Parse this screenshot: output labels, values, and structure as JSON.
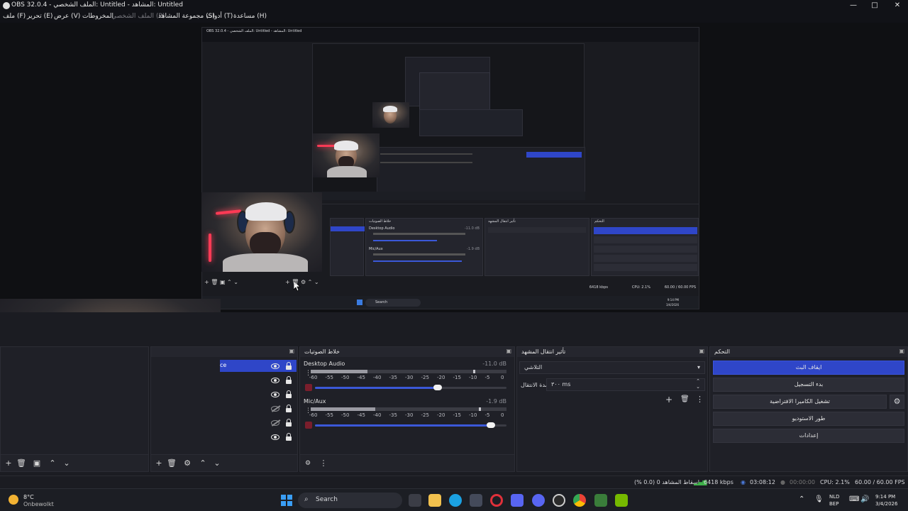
{
  "window": {
    "title": "OBS 32.0.4 - الملف الشخصي: Untitled - المشاهد: Untitled",
    "controls": {
      "minimize": "—",
      "maximize": "□",
      "close": "✕"
    }
  },
  "menu": {
    "items": [
      {
        "label": "ملف (F)"
      },
      {
        "label": "تحرير (E)"
      },
      {
        "label": "عرض (V)"
      },
      {
        "label": "المخروطات"
      },
      {
        "label": "الملف الشخصي (P)"
      },
      {
        "label": "مجموعة المشاهد (S)"
      },
      {
        "label": "أدوات (T)"
      },
      {
        "label": "مساعدة (H)"
      }
    ]
  },
  "nested": {
    "title": "OBS 32.0.4 - الملف الشخصي: Untitled - المشاهد: Untitled",
    "search": "Search",
    "status_fps": "60.00 / 60.00 FPS",
    "status_cpu": "CPU: 2.1%",
    "status_kbps": "6418 kbps",
    "mixer_title": "خلاط الصوتيات",
    "transition_title": "تأثير انتقال المشهد",
    "controls_title": "التحكم",
    "ch1": "Desktop Audio",
    "ch2": "Mic/Aux",
    "ch1_db": "-11.0 dB",
    "ch2_db": "-1.9 dB",
    "time": "9:14 PM",
    "date": "3/4/2026"
  },
  "sources": {
    "selected_label": "ce"
  },
  "mixer": {
    "title": "خلاط الصوتيات",
    "channels": [
      {
        "name": "Desktop Audio",
        "db": "-11.0 dB",
        "level": 0.29,
        "peak": 0.83,
        "volume": 0.64
      },
      {
        "name": "Mic/Aux",
        "db": "-1.9 dB",
        "level": 0.33,
        "peak": 0.86,
        "volume": 0.92
      }
    ],
    "scale": [
      "-60",
      "-55",
      "-50",
      "-45",
      "-40",
      "-35",
      "-30",
      "-25",
      "-20",
      "-15",
      "-10",
      "-5",
      "0"
    ]
  },
  "transitions": {
    "title": "تأثير انتقال المشهد",
    "selected": "التلاشي",
    "duration_label": "مدة الانتقال",
    "duration_value": "٣٠٠ ms"
  },
  "controls": {
    "title": "التحكم",
    "buttons": [
      {
        "label": "ايقاف البث"
      },
      {
        "label": "بدء التسجيل"
      },
      {
        "label": "تشغيل الكاميرا الافتراضية"
      },
      {
        "label": "طور الاستوديو"
      },
      {
        "label": "إعدادات"
      }
    ]
  },
  "status": {
    "dropped": "إسقاط المشاهد 0 (0.0 %)",
    "kbps": "6418 kbps",
    "live": "03:08:12",
    "rec": "00:00:00",
    "cpu": "CPU: 2.1%",
    "fps": "60.00 / 60.00 FPS"
  },
  "taskbar": {
    "weather_temp": "8°C",
    "weather_desc": "Onbewolkt",
    "search": "Search",
    "lang": "NLD",
    "lang2": "BEP",
    "time": "9:14 PM",
    "date": "3/4/2026"
  },
  "colors": {
    "accent": "#2f46c8",
    "meter": "#9a9aa2",
    "volume": "#3b58d8",
    "neon": "#ff3a55"
  }
}
